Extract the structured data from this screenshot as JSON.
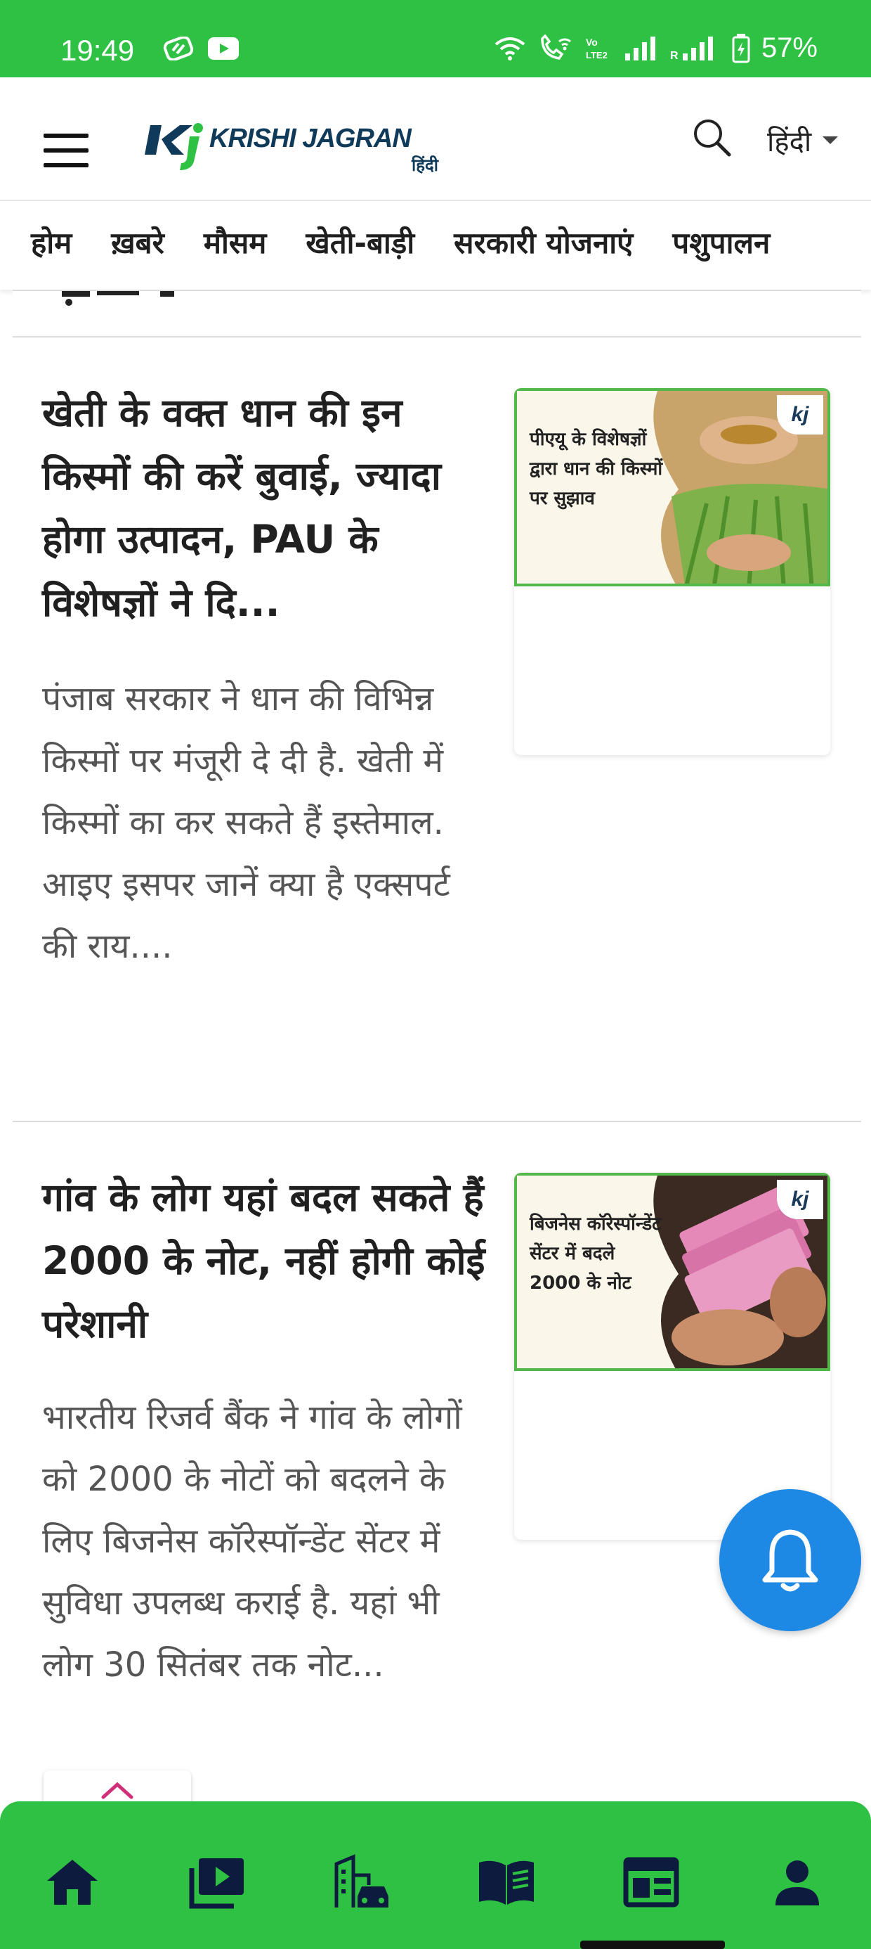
{
  "status_bar": {
    "time": "19:49",
    "battery": "57%",
    "icons": [
      "notification-app-icon",
      "youtube-icon",
      "wifi-icon",
      "wifi-call-icon",
      "volte-icon",
      "signal-icon",
      "signal-roaming-icon",
      "battery-icon"
    ]
  },
  "header": {
    "logo_text": "KRISHI JAGRAN",
    "logo_sub": "हिंदी",
    "language": "हिंदी"
  },
  "nav": {
    "items": [
      "होम",
      "ख़बरे",
      "मौसम",
      "खेती-बाड़ी",
      "सरकारी योजनाएं",
      "पशुपालन"
    ]
  },
  "articles": [
    {
      "title": "खेती के वक्त धान की इन किस्मों की करें बुवाई, ज्यादा होगा उत्पादन, PAU के विशेषज्ञों ने दि...",
      "description": "पंजाब सरकार ने धान की विभिन्न किस्मों पर मंजूरी दे दी है. खेती में किस्मों का कर सकते हैं इस्तेमाल. आइए इसपर जानें क्या है एक्सपर्ट की राय....",
      "thumb_caption": "पीएयू के विशेषज्ञों द्वारा धान की किस्मों पर सुझाव",
      "badge": "kj"
    },
    {
      "title": "गांव के लोग यहां बदल सकते हैं 2000 के नोट, नहीं होगी कोई परेशानी",
      "description": "भारतीय रिजर्व बैंक ने गांव के लोगों को 2000 के नोटों को बदलने के लिए बिजनेस कॉरेस्पॉन्डेंट सेंटर में सुविधा उपलब्ध कराई है. यहां भी लोग 30 सितंबर तक नोट...",
      "thumb_caption": "बिजनेस कॉरेस्पॉन्डेंट सेंटर में बदले 2000 के नोट",
      "badge": "kj"
    }
  ],
  "bottom_nav": {
    "items": [
      "home-icon",
      "video-library-icon",
      "city-transport-icon",
      "magazine-icon",
      "news-icon",
      "account-icon"
    ],
    "active_index": 4
  },
  "colors": {
    "brand_green": "#2ec143",
    "fab_blue": "#1e88e5",
    "logo_navy": "#0f3a5a"
  }
}
